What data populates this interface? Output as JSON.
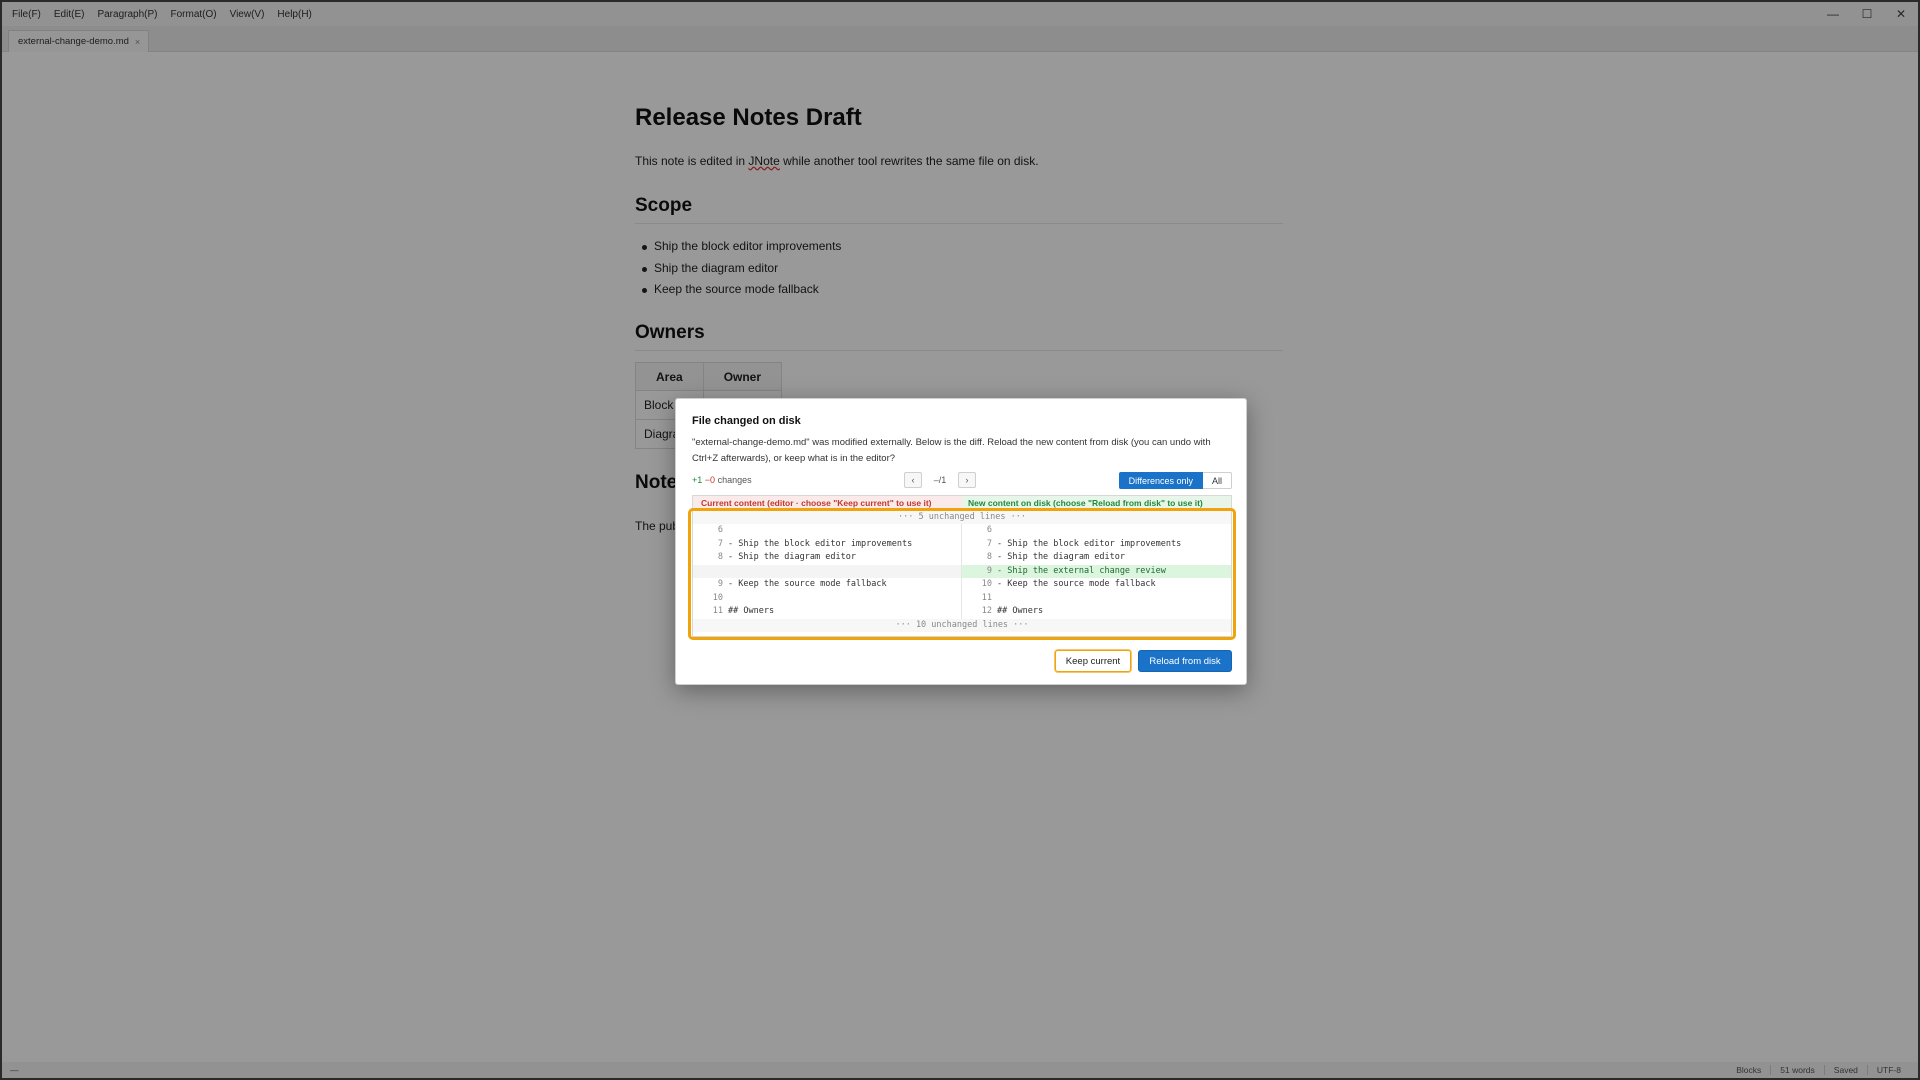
{
  "menu": [
    "File(F)",
    "Edit(E)",
    "Paragraph(P)",
    "Format(O)",
    "View(V)",
    "Help(H)"
  ],
  "window_controls": {
    "minimize": "—",
    "maximize": "☐",
    "close": "✕"
  },
  "tab": {
    "name": "external-change-demo.md",
    "close": "×"
  },
  "doc": {
    "title": "Release Notes Draft",
    "intro_before": "This note is edited in ",
    "intro_app": "JNote",
    "intro_after": " while another tool rewrites the same file on disk.",
    "scope_heading": "Scope",
    "scope_items": [
      "Ship the block editor improvements",
      "Ship the diagram editor",
      "Keep the source mode fallback"
    ],
    "owners_heading": "Owners",
    "table_headers": [
      "Area",
      "Owner"
    ],
    "table_rows": [
      [
        "Block",
        ""
      ],
      [
        "Diagra",
        ""
      ]
    ],
    "notes_heading": "Note",
    "notes_text": "The pub"
  },
  "status": {
    "left": "—",
    "mode": "Blocks",
    "words": "51 words",
    "saved": "Saved",
    "encoding": "UTF-8"
  },
  "dialog": {
    "title": "File changed on disk",
    "message": "\"external-change-demo.md\" was modified externally. Below is the diff. Reload the new content from disk (you can undo with Ctrl+Z afterwards), or keep what is in the editor?",
    "added": "+1",
    "removed": "−0",
    "changes_label": "changes",
    "prev": "‹",
    "next": "›",
    "nav_count": "–/1",
    "toggle_diff_only": "Differences only",
    "toggle_all": "All",
    "header_current": "Current content (editor · choose \"Keep current\" to use it)",
    "header_new": "New content on disk (choose \"Reload from disk\" to use it)",
    "fold_top": "··· 5 unchanged lines ···",
    "fold_bottom": "··· 10 unchanged lines ···",
    "rows": [
      {
        "l_ln": "6",
        "l_text": "",
        "r_ln": "6",
        "r_text": ""
      },
      {
        "l_ln": "7",
        "l_text": "- Ship the block editor improvements",
        "r_ln": "7",
        "r_text": "- Ship the block editor improvements"
      },
      {
        "l_ln": "8",
        "l_text": "- Ship the diagram editor",
        "r_ln": "8",
        "r_text": "- Ship the diagram editor"
      },
      {
        "l_ln": "",
        "l_text": "",
        "r_ln": "9",
        "r_text": "- Ship the external change review"
      },
      {
        "l_ln": "9",
        "l_text": "- Keep the source mode fallback",
        "r_ln": "10",
        "r_text": "- Keep the source mode fallback"
      },
      {
        "l_ln": "10",
        "l_text": "",
        "r_ln": "11",
        "r_text": ""
      },
      {
        "l_ln": "11",
        "l_text": "## Owners",
        "r_ln": "12",
        "r_text": "## Owners"
      }
    ],
    "keep_label": "Keep current",
    "reload_label": "Reload from disk"
  }
}
